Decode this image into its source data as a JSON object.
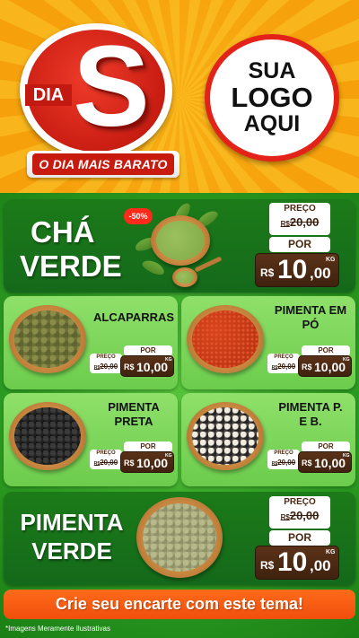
{
  "header": {
    "badge_dia": "DIA",
    "badge_s": "S",
    "badge_slogan": "O DIA MAIS BARATO",
    "logo_line1": "SUA",
    "logo_line2": "LOGO",
    "logo_line3": "AQUI"
  },
  "labels": {
    "preco": "PREÇO",
    "por": "POR",
    "currency": "R$",
    "unit": "KG"
  },
  "products": {
    "cha_verde": {
      "name_line1": "CHÁ",
      "name_line2": "VERDE",
      "discount": "-50%",
      "old_price": "20,00",
      "price_int": "10",
      "price_dec": ",00"
    },
    "alcaparras": {
      "name": "ALCAPARRAS",
      "old_price": "20,00",
      "price": "10,00"
    },
    "pimenta_po": {
      "name_line1": "PIMENTA EM",
      "name_line2": "PÓ",
      "old_price": "20,00",
      "price": "10,00"
    },
    "pimenta_preta": {
      "name_line1": "PIMENTA",
      "name_line2": "PRETA",
      "old_price": "20,00",
      "price": "10,00"
    },
    "pimenta_pb": {
      "name_line1": "PIMENTA P.",
      "name_line2": "E B.",
      "old_price": "20,00",
      "price": "10,00"
    },
    "pimenta_verde": {
      "name_line1": "PIMENTA",
      "name_line2": "VERDE",
      "old_price": "20,00",
      "price_int": "10",
      "price_dec": ",00"
    }
  },
  "cta": "Crie seu encarte com este tema!",
  "footnote": "*Imagens Meramente Ilustrativas",
  "colors": {
    "orange_bg": "#f6a10c",
    "red": "#e3231a",
    "green_dark": "#1c7b19",
    "green_light": "#8fe06a",
    "brown": "#4a2a14",
    "cta_orange": "#f04e0c"
  }
}
